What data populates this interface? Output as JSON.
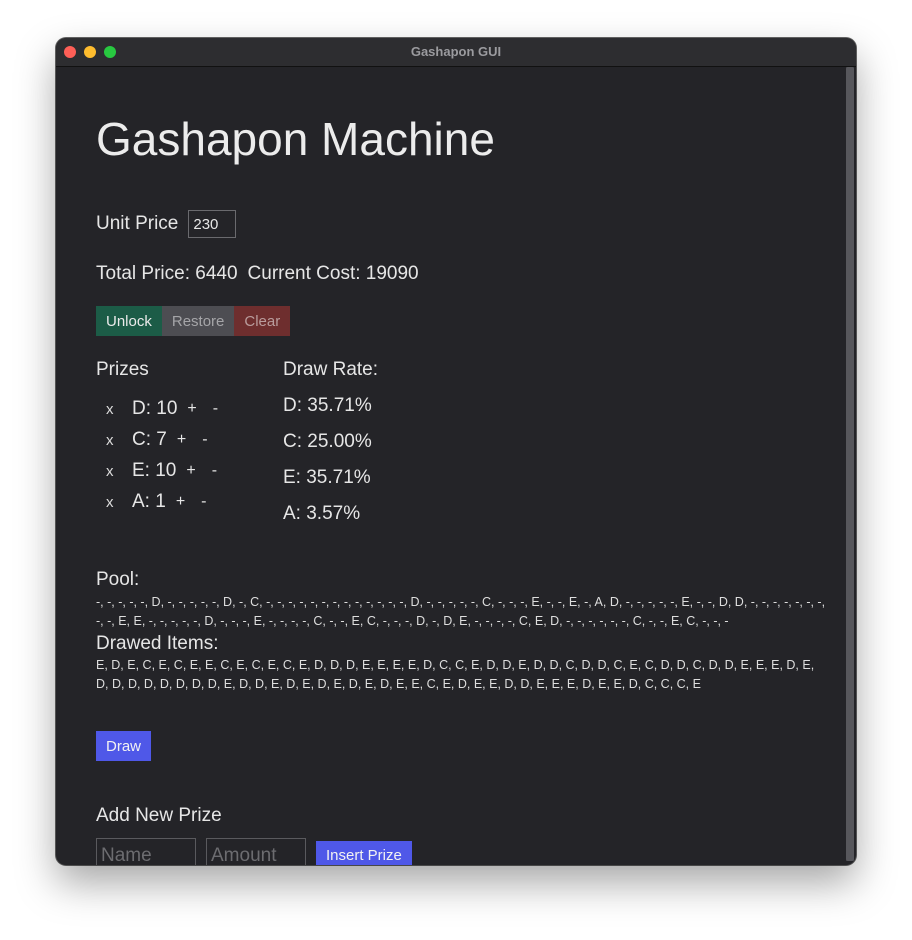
{
  "window": {
    "title": "Gashapon GUI"
  },
  "heading": "Gashapon Machine",
  "unit_price": {
    "label": "Unit Price",
    "value": "230"
  },
  "totals": {
    "total_price": "Total Price: 6440",
    "current_cost": "Current Cost: 19090"
  },
  "actions": {
    "unlock": "Unlock",
    "restore": "Restore",
    "clear": "Clear"
  },
  "prizes": {
    "title": "Prizes",
    "remove_label": "x",
    "plus_label": "+",
    "minus_label": "-",
    "items": [
      {
        "label": "D: 10"
      },
      {
        "label": "C: 7"
      },
      {
        "label": "E: 10"
      },
      {
        "label": "A: 1"
      }
    ]
  },
  "draw_rate": {
    "title": "Draw Rate:",
    "items": [
      "D: 35.71%",
      "C: 25.00%",
      "E: 35.71%",
      "A: 3.57%"
    ]
  },
  "pool": {
    "title": "Pool:",
    "text": "-, -, -, -, -, D, -, -, -, -, -, D, -, C, -, -, -, -, -, -, -, -, -, -, -, -, -, D, -, -, -, -, -, C, -, -, -, E, -, -, E, -, A, D, -, -, -, -, -, E, -, -, D, D, -, -, -, -, -, -, -, -, -, E, E, -, -, -, -, -, D, -, -, -, E, -, -, -, -, C, -, -, E, C, -, -, -, D, -, D, E, -, -, -, -, C, E, D, -, -, -, -, -, -, C, -, -, E, C, -, -, -"
  },
  "drawed": {
    "title": "Drawed Items:",
    "text": "E, D, E, C, E, C, E, E, C, E, C, E, C, E, D, D, D, E, E, E, E, D, C, C, E, D, D, E, D, D, C, D, D, C, E, C, D, D, C, D, D, E, E, E, D, E, D, D, D, D, D, D, D, D, E, D, D, E, D, E, D, E, D, E, D, E, E, C, E, D, E, E, D, D, E, E, E, D, E, E, D, C, C, C, E"
  },
  "draw_button": "Draw",
  "add_prize": {
    "title": "Add New Prize",
    "name_placeholder": "Name",
    "amount_placeholder": "Amount",
    "insert_label": "Insert Prize"
  },
  "colors": {
    "window_bg": "#242428",
    "accent": "#4f58e8",
    "unlock": "#1c5c47",
    "restore": "#4d4d52",
    "clear": "#6e2e2e"
  }
}
